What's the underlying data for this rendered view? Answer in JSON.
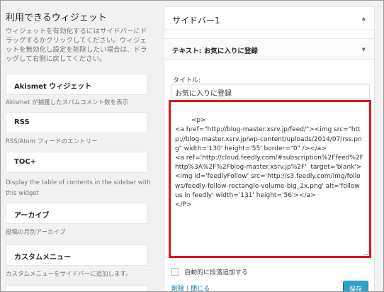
{
  "available": {
    "title": "利用できるウィジェット",
    "description": "ウィジェットを有効化するにはサイドバーにドラッグするかクリックしてください。ウィジェットを無効化し設定を削除したい場合は、ドラッグして右側に戻してください。",
    "widgets": [
      {
        "name": "Akismet ウィジェット",
        "description": "Akismet が捕獲したスパムコメント数を表示"
      },
      {
        "name": "RSS",
        "description": "RSS/Atom フィードのエントリー"
      },
      {
        "name": "TOC+",
        "description": "Display the table of contents in the sidebar with this widget"
      },
      {
        "name": "アーカイブ",
        "description": "投稿の月別アーカイブ"
      },
      {
        "name": "カスタムメニュー",
        "description": "カスタムメニューをサイドバーに追加します。"
      },
      {
        "name": "",
        "description": ""
      }
    ]
  },
  "sidebar": {
    "title": "サイドバー1",
    "widget": {
      "header": "テキスト: お気に入りに登録",
      "title_label": "タイトル:",
      "title_value": "お気に入りに登録",
      "content": "<p>\n<a href=\"http://blog-master.xsrv.jp/feed/\"><img src=\"http://blog-master.xsrv.jp/wp-content/uploads/2014/07/rss.png\" width='130' height='55' border=\"0\" /></a>\n<a ref='http://cloud.feedly.com/#subscription%2Ffeed%2Fhttp%3A%2F%2Fblog-master.xsrv.jp%2F'  target='blank'><img id='feedlyFollow' src='http://s3.feedly.com/img/follows/feedly-follow-rectangle-volume-big_2x.png' alt='follow us in feedly' width='131' height='56'></a>\n</P>",
      "auto_paragraph_label": "自動的に段落追加する",
      "delete_label": "削除",
      "separator": "|",
      "close_label": "閉じる",
      "save_label": "保存"
    }
  },
  "colors": {
    "highlight_border": "#e0161f",
    "save_button": "#2ea2cc",
    "link": "#0073aa"
  }
}
